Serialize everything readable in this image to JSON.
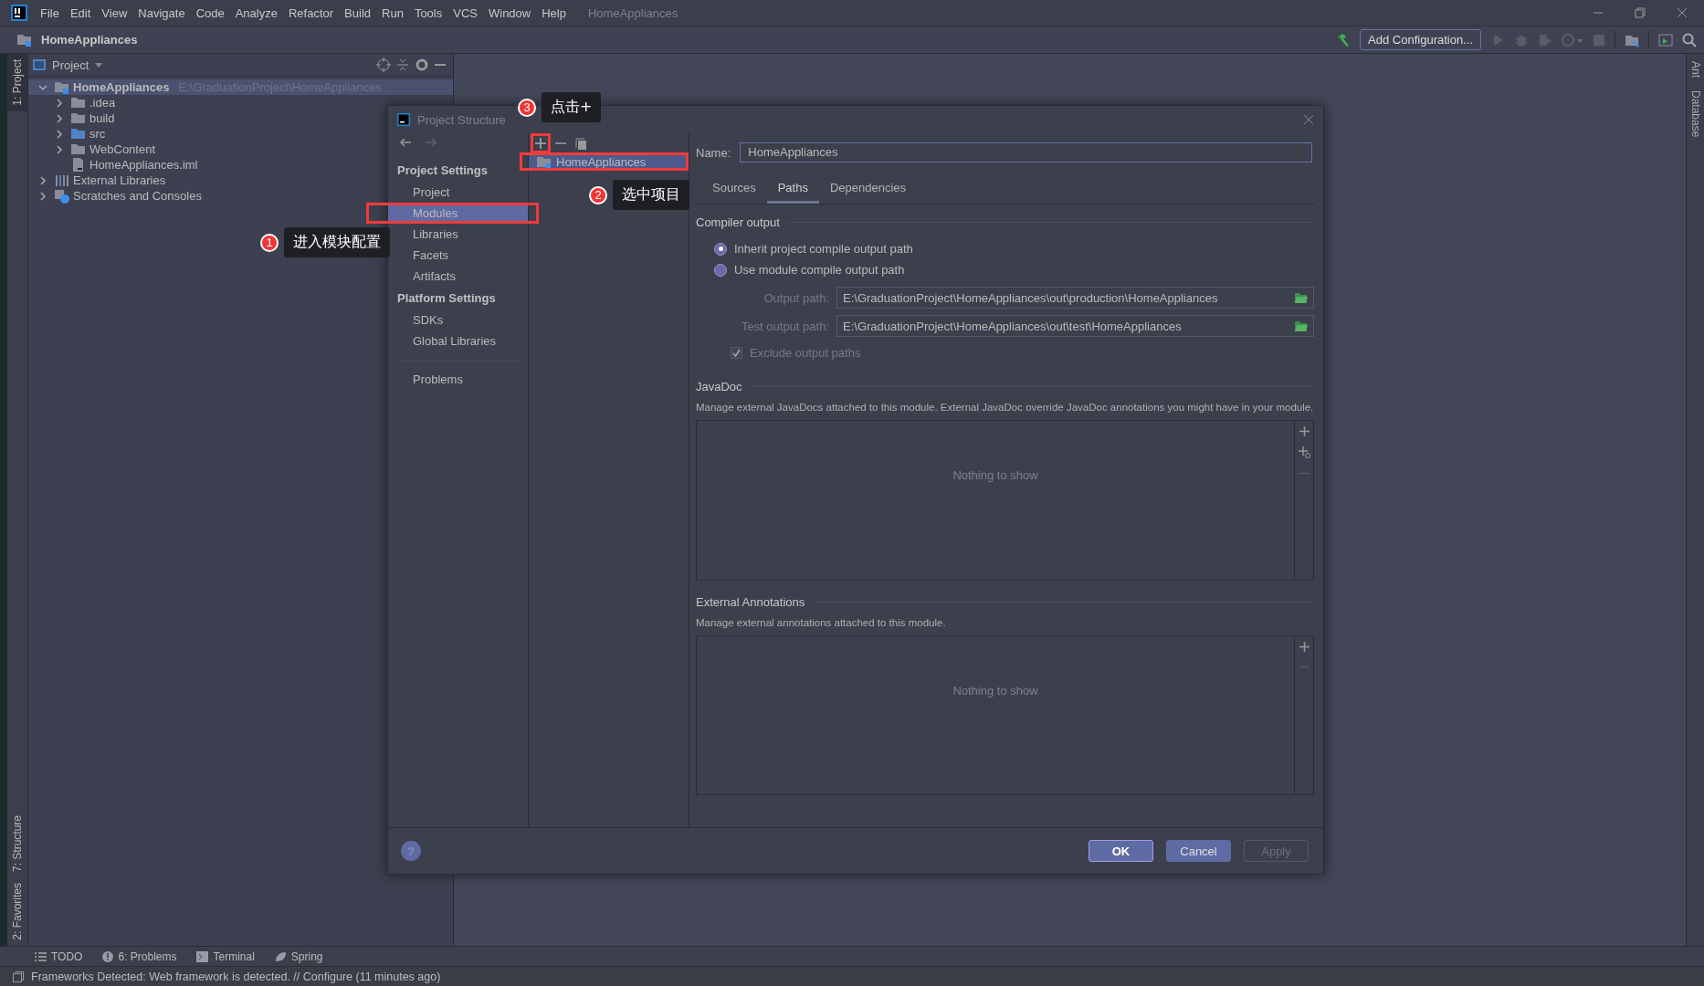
{
  "menu_bar": {
    "items": [
      "File",
      "Edit",
      "View",
      "Navigate",
      "Code",
      "Analyze",
      "Refactor",
      "Build",
      "Run",
      "Tools",
      "VCS",
      "Window",
      "Help"
    ],
    "project_title": "HomeAppliances"
  },
  "nav_bar": {
    "breadcrumb": "HomeAppliances",
    "run_config": "Add Configuration..."
  },
  "left_stripe": {
    "top": [
      {
        "label": "1: Project",
        "selected": true
      }
    ],
    "bottom": [
      {
        "label": "7: Structure",
        "selected": false
      },
      {
        "label": "2: Favorites",
        "selected": false
      }
    ]
  },
  "right_stripe": [
    {
      "label": "Ant"
    },
    {
      "label": "Database"
    }
  ],
  "project_panel": {
    "title": "Project",
    "tree": [
      {
        "kind": "module",
        "label": "HomeAppliances",
        "path": "E:\\GraduationProject\\HomeAppliances",
        "expanded": true,
        "selected": true,
        "children": [
          {
            "kind": "folder",
            "label": ".idea",
            "expanded": false,
            "selected": false
          },
          {
            "kind": "folder",
            "label": "build",
            "expanded": false,
            "selected": false
          },
          {
            "kind": "source",
            "label": "src",
            "expanded": false,
            "selected": false
          },
          {
            "kind": "folder",
            "label": "WebContent",
            "expanded": false,
            "selected": false
          },
          {
            "kind": "file",
            "label": "HomeAppliances.iml",
            "selected": false
          }
        ]
      },
      {
        "kind": "libraries",
        "label": "External Libraries",
        "expanded": false,
        "selected": false
      },
      {
        "kind": "scratches",
        "label": "Scratches and Consoles",
        "expanded": false,
        "selected": false
      }
    ]
  },
  "dialog": {
    "title": "Project Structure",
    "nav": [
      {
        "heading": "Project Settings",
        "items": [
          {
            "label": "Project",
            "selected": false
          },
          {
            "label": "Modules",
            "selected": true
          },
          {
            "label": "Libraries",
            "selected": false
          },
          {
            "label": "Facets",
            "selected": false
          },
          {
            "label": "Artifacts",
            "selected": false
          }
        ]
      },
      {
        "heading": "Platform Settings",
        "items": [
          {
            "label": "SDKs",
            "selected": false
          },
          {
            "label": "Global Libraries",
            "selected": false
          }
        ]
      },
      {
        "items": [
          {
            "label": "Problems",
            "selected": false
          }
        ]
      }
    ],
    "modules": [
      {
        "label": "HomeAppliances",
        "selected": true
      }
    ],
    "name_label": "Name:",
    "name_value": "HomeAppliances",
    "tabs": [
      {
        "label": "Sources",
        "selected": false
      },
      {
        "label": "Paths",
        "selected": true
      },
      {
        "label": "Dependencies",
        "selected": false
      }
    ],
    "compiler_output": {
      "heading": "Compiler output",
      "options": [
        {
          "label": "Inherit project compile output path",
          "selected": true
        },
        {
          "label": "Use module compile output path",
          "selected": false
        }
      ],
      "paths": [
        {
          "label": "Output path:",
          "value": "E:\\GraduationProject\\HomeAppliances\\out\\production\\HomeAppliances",
          "disabled": true
        },
        {
          "label": "Test output path:",
          "value": "E:\\GraduationProject\\HomeAppliances\\out\\test\\HomeAppliances",
          "disabled": true
        }
      ],
      "exclude": {
        "label": "Exclude output paths",
        "checked": true,
        "disabled": true
      }
    },
    "javadoc": {
      "heading": "JavaDoc",
      "description": "Manage external JavaDocs attached to this module. External JavaDoc override JavaDoc annotations you might have in your module.",
      "empty_text": "Nothing to show"
    },
    "external_annotations": {
      "heading": "External Annotations",
      "description": "Manage external annotations attached to this module.",
      "empty_text": "Nothing to show"
    },
    "help": "?",
    "buttons": [
      {
        "label": "OK",
        "default": true,
        "disabled": false
      },
      {
        "label": "Cancel",
        "default": false,
        "disabled": false
      },
      {
        "label": "Apply",
        "default": false,
        "disabled": true
      }
    ]
  },
  "callouts": [
    {
      "number": "1",
      "text": "进入模块配置"
    },
    {
      "number": "2",
      "text": "选中项目"
    },
    {
      "number": "3",
      "text": "点击+"
    }
  ],
  "tool_tabs": [
    {
      "kind": "todo",
      "label": "TODO"
    },
    {
      "kind": "problems",
      "label": "6: Problems"
    },
    {
      "kind": "terminal",
      "label": "Terminal"
    },
    {
      "kind": "spring",
      "label": "Spring"
    }
  ],
  "status_bar": {
    "message": "Frameworks Detected: Web framework is detected. // Configure (11 minutes ago)"
  }
}
